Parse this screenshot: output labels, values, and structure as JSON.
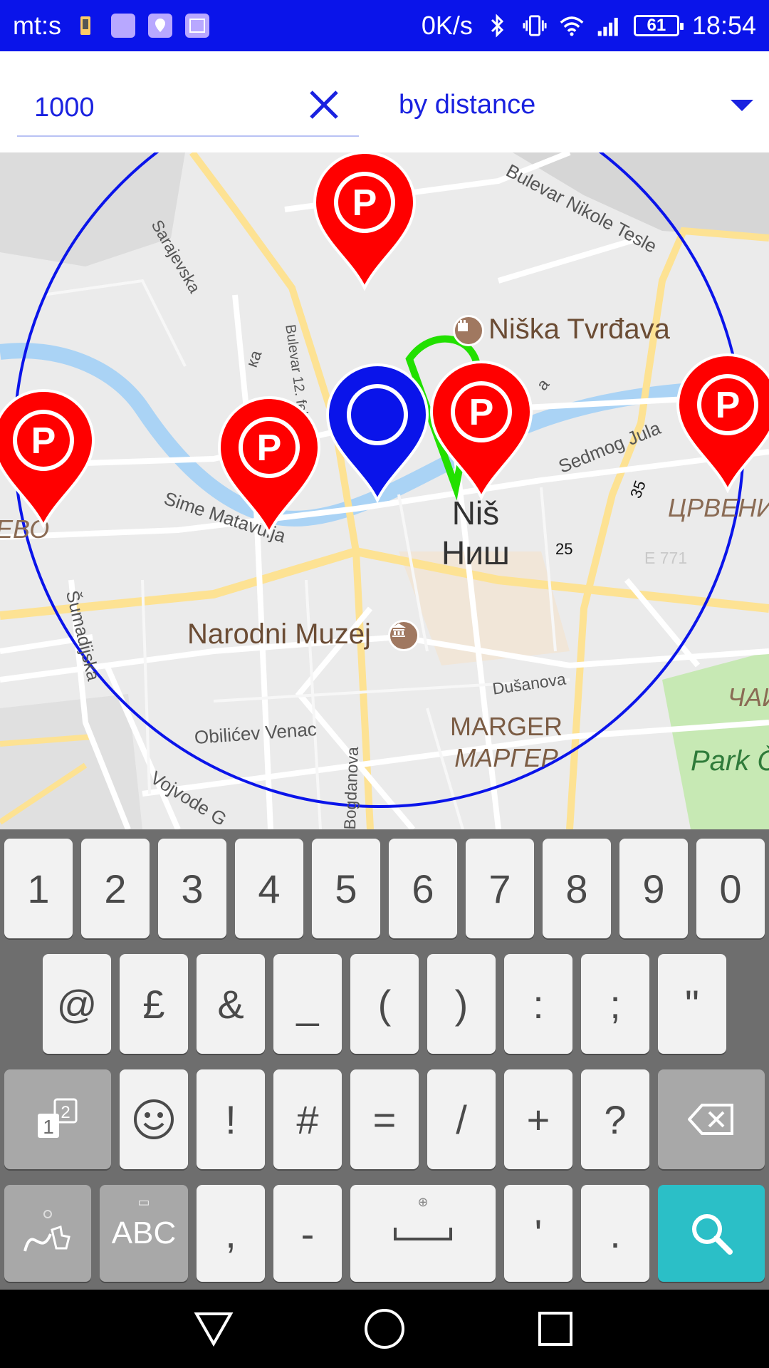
{
  "status_bar": {
    "carrier": "mt:s",
    "net_speed": "0K/s",
    "battery": "61",
    "time": "18:54",
    "icons": [
      "phone-charge-icon",
      "keyboard-icon",
      "location-app-icon",
      "gallery-icon",
      "bluetooth-icon",
      "vibrate-icon",
      "wifi-icon",
      "signal-icon",
      "battery-icon"
    ]
  },
  "search": {
    "radius_value": "1000",
    "sort_label": "by distance"
  },
  "map": {
    "colors": {
      "radius_circle": "#0a14ea",
      "parking_pin": "#ff0000",
      "user_pin": "#0a14ea",
      "route": "#22e000",
      "river": "#aad3f5",
      "road_major": "#fde293",
      "park": "#c7e9b4"
    },
    "labels": {
      "sarajevska": "Sarajevska",
      "bulevar_nikole_tesle": "Bulevar Nikole Tesle",
      "niska_tvrdjava": "Niška Tvrđava",
      "bulevar_12_feb": "Bulevar 12. feb",
      "sedmog_jula": "Sedmog Jula",
      "sime_matavulja": "Sime Matavulja",
      "nis_lat": "Niš",
      "nis_cyr": "Ниш",
      "road_25": "25",
      "road_35": "35",
      "e771": "E 771",
      "crveni_krst": "ЦРВЕНИ",
      "sumadijska": "Šumadijska",
      "narodni_muzej": "Narodni Muzej",
      "dusanova": "Dušanova",
      "marger_lat": "MARGER",
      "marger_cyr": "МАРГЕР",
      "obilicev_venac": "Obilićev Venac",
      "vojvode": "Vojvode G",
      "bogdanova": "Bogdanova",
      "park": "Park Č",
      "cair": "ЧАИ",
      "edge_left": "ЕВО",
      "ulica_ka": "ка",
      "tvrdjava_a": "a"
    },
    "parking_pins": [
      "P",
      "P",
      "P",
      "P",
      "P"
    ]
  },
  "keyboard": {
    "row1": [
      "1",
      "2",
      "3",
      "4",
      "5",
      "6",
      "7",
      "8",
      "9",
      "0"
    ],
    "row2": [
      "@",
      "£",
      "&",
      "_",
      "(",
      ")",
      ":",
      ";",
      "\""
    ],
    "row3": [
      "!",
      "#",
      "=",
      "/",
      "+",
      "?"
    ],
    "row4": {
      "abc": "ABC",
      "comma": ",",
      "dash": "-",
      "apostrophe": "'",
      "period": "."
    }
  },
  "nav_bar": {
    "buttons": [
      "back-icon",
      "home-icon",
      "recents-icon"
    ]
  }
}
